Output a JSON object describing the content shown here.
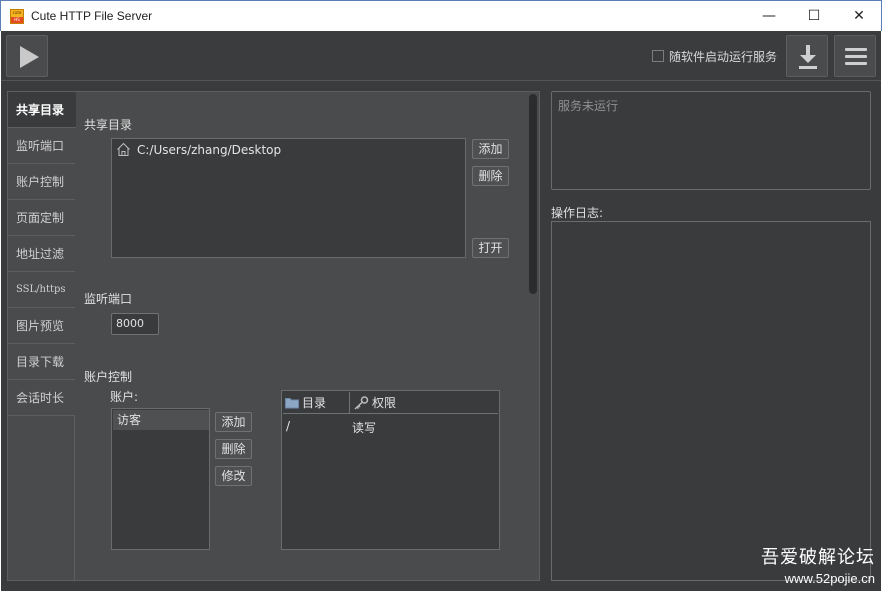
{
  "window": {
    "title": "Cute HTTP File Server",
    "icon_top_text": "cute",
    "icon_bottom_text": "HS",
    "minimize_glyph": "—",
    "maximize_glyph": "☐",
    "close_glyph": "✕"
  },
  "toolbar": {
    "autostart_label": "随软件启动运行服务",
    "autostart_checked": false
  },
  "tabs": [
    {
      "label": "共享目录",
      "active": true
    },
    {
      "label": "监听端口",
      "active": false
    },
    {
      "label": "账户控制",
      "active": false
    },
    {
      "label": "页面定制",
      "active": false
    },
    {
      "label": "地址过滤",
      "active": false
    },
    {
      "label": "SSL/https",
      "active": false
    },
    {
      "label": "图片预览",
      "active": false
    },
    {
      "label": "目录下载",
      "active": false
    },
    {
      "label": "会话时长",
      "active": false
    }
  ],
  "shared_dir": {
    "title": "共享目录",
    "items": [
      "C:/Users/zhang/Desktop"
    ],
    "add_label": "添加",
    "delete_label": "删除",
    "open_label": "打开"
  },
  "port": {
    "title": "监听端口",
    "value": "8000"
  },
  "accounts": {
    "title": "账户控制",
    "list_label": "账户:",
    "items": [
      "访客"
    ],
    "add_label": "添加",
    "delete_label": "删除",
    "edit_label": "修改",
    "table": {
      "col_dir": "目录",
      "col_perm": "权限",
      "rows": [
        {
          "dir": "/",
          "perm": "读写"
        }
      ]
    }
  },
  "status": {
    "text": "服务未运行"
  },
  "log": {
    "label": "操作日志:"
  },
  "watermark": {
    "line1": "吾爱破解论坛",
    "line2": "www.52pojie.cn"
  },
  "colors": {
    "background": "#3a3b3d",
    "panel": "#4a4b4d",
    "border": "#6a6b6d",
    "text": "#e0e0e0"
  }
}
